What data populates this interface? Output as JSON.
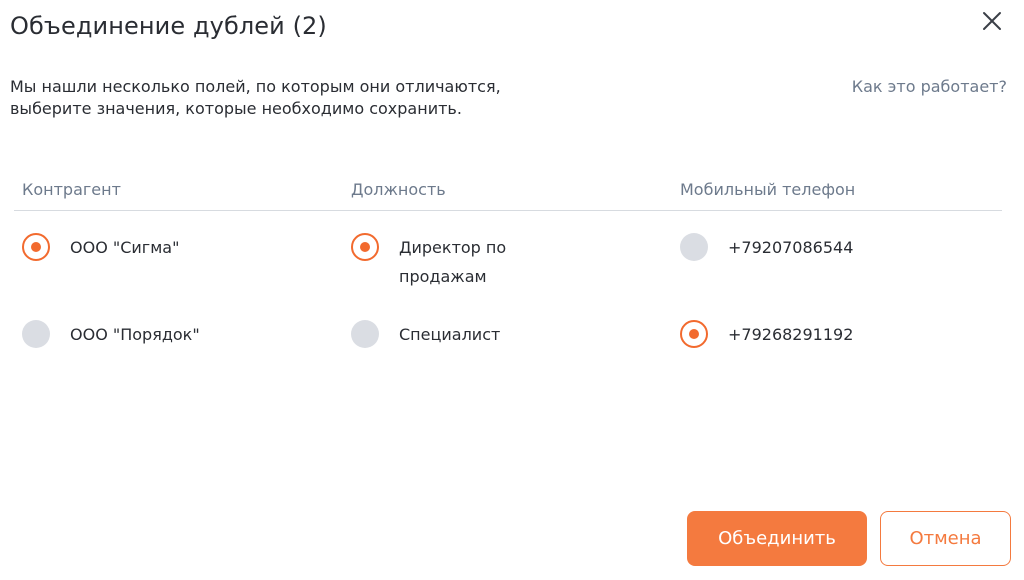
{
  "dialog": {
    "title": "Объединение дублей (2)",
    "description_line1": "Мы нашли несколько полей, по которым они отличаются,",
    "description_line2": "выберите значения, которые необходимо сохранить.",
    "help_link": "Как это работает?",
    "close_icon": "close-icon"
  },
  "columns": [
    {
      "header": "Контрагент",
      "options": [
        {
          "label": "ООО \"Сигма\"",
          "selected": true
        },
        {
          "label": "ООО \"Порядок\"",
          "selected": false
        }
      ]
    },
    {
      "header": "Должность",
      "options": [
        {
          "label_line1": "Директор по",
          "label_line2": "продажам",
          "selected": true
        },
        {
          "label": "Специалист",
          "selected": false
        }
      ]
    },
    {
      "header": "Мобильный телефон",
      "options": [
        {
          "label": "+79207086544",
          "selected": false
        },
        {
          "label": "+79268291192",
          "selected": true
        }
      ]
    }
  ],
  "buttons": {
    "merge": "Объединить",
    "cancel": "Отмена"
  },
  "colors": {
    "accent": "#f47a3f",
    "radio_off": "#dadde3",
    "muted_text": "#6d7a8c"
  }
}
